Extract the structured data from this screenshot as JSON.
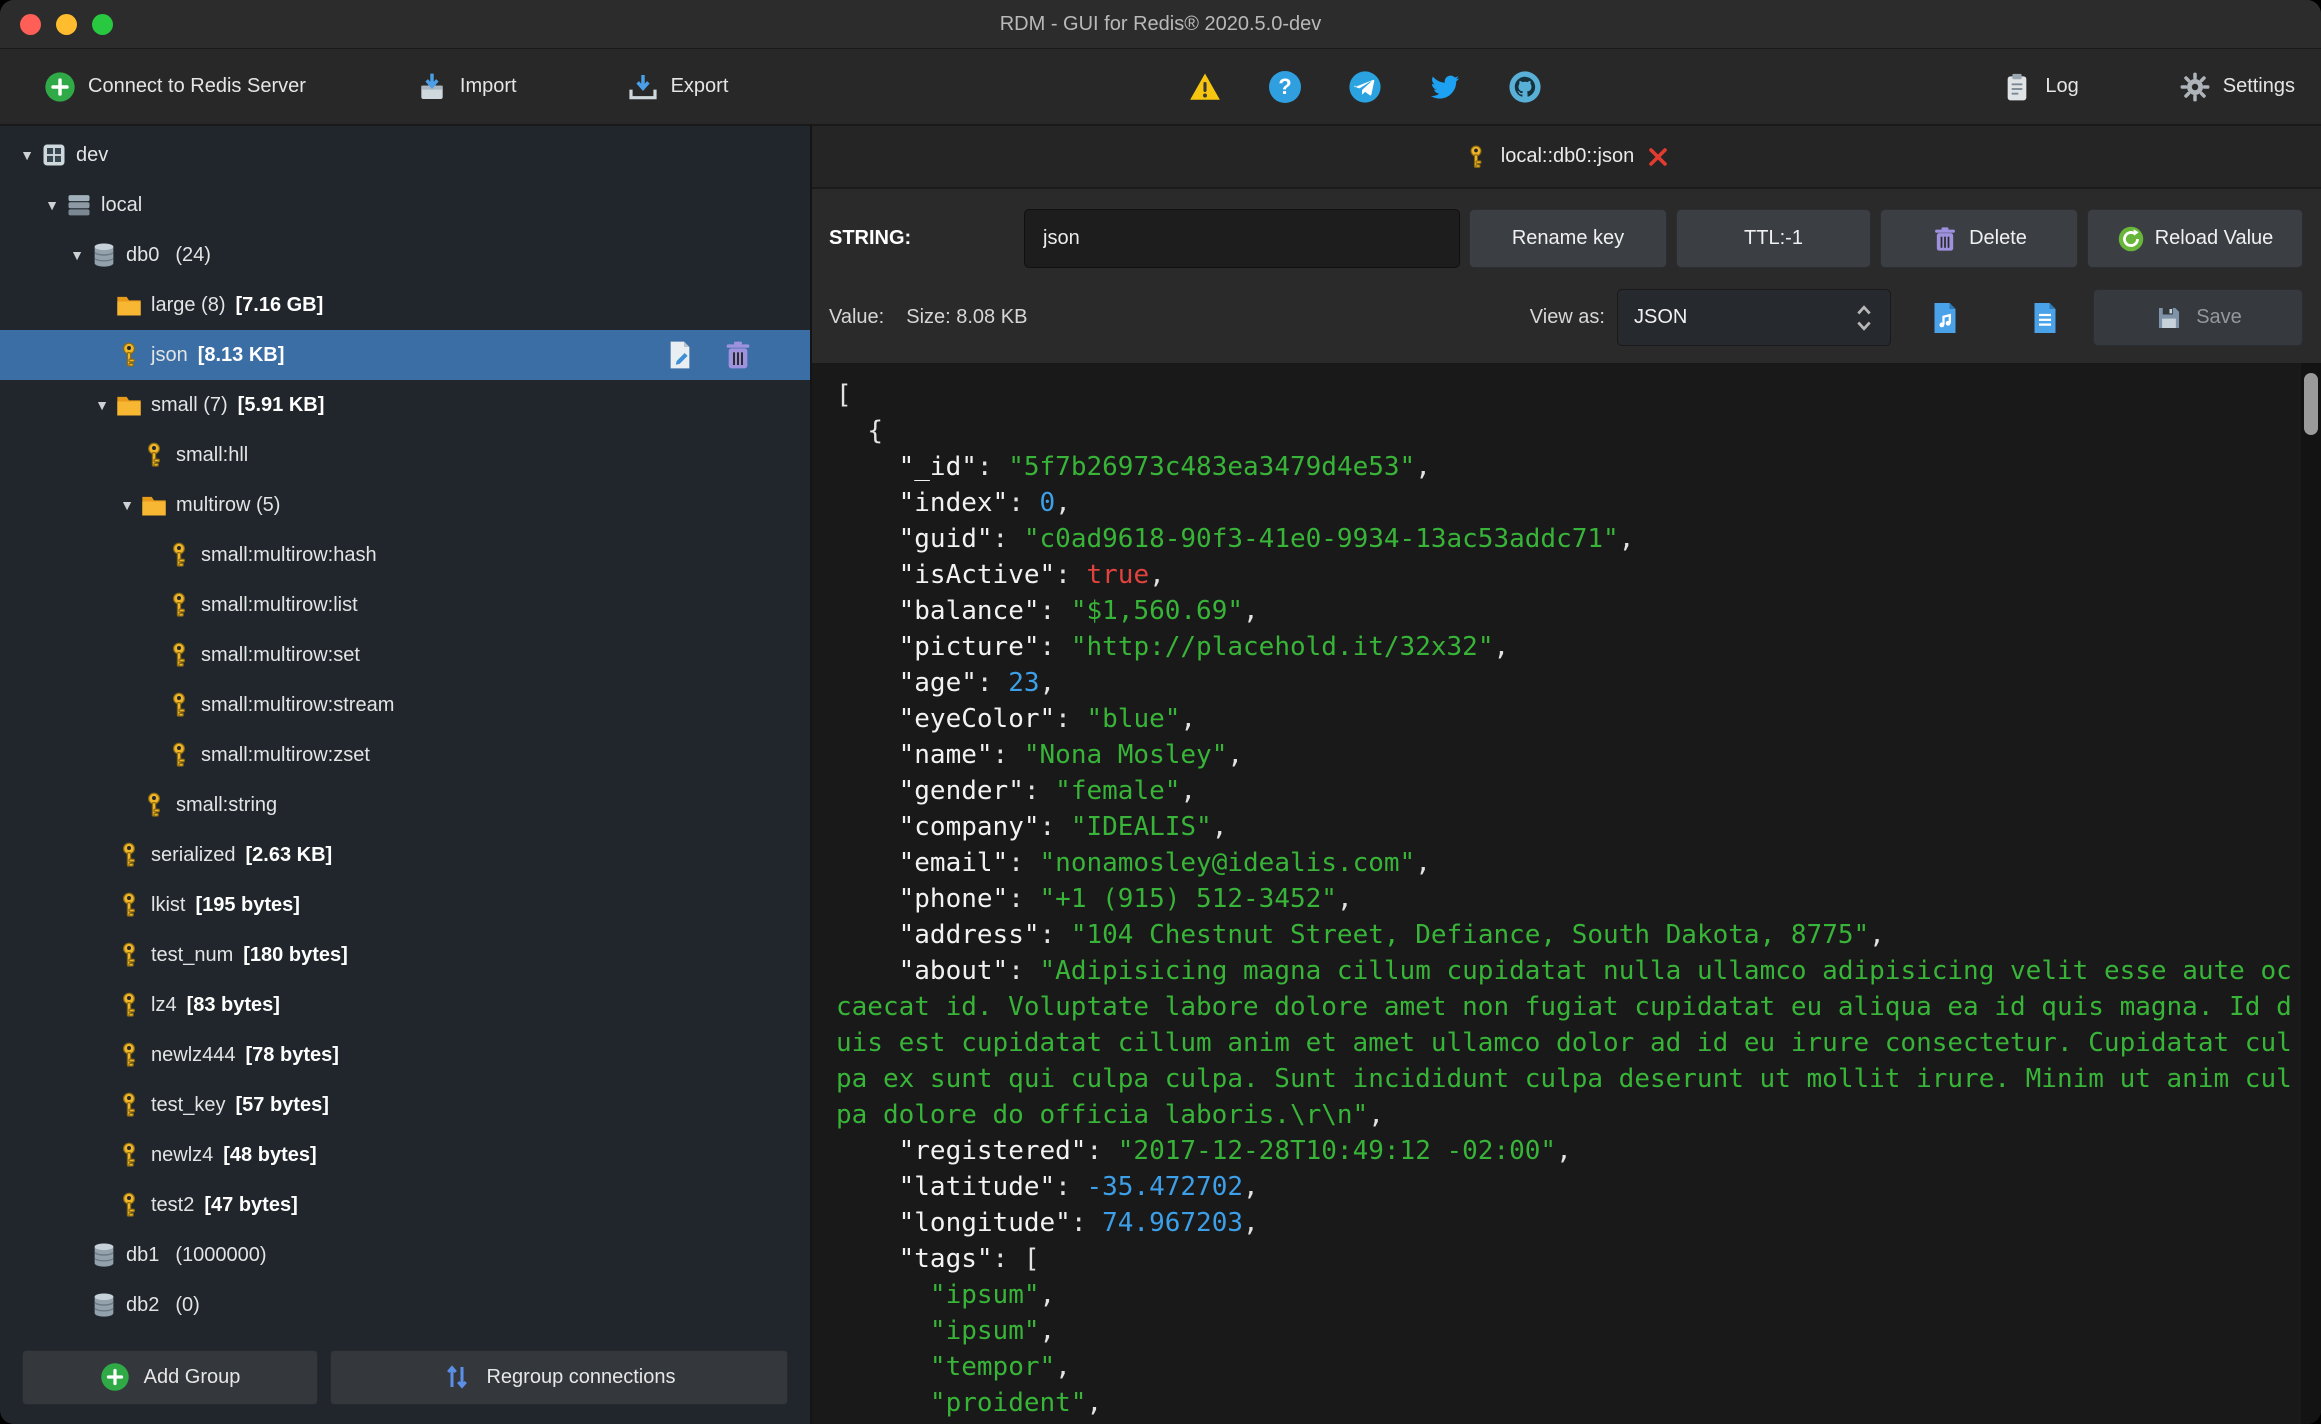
{
  "window": {
    "title": "RDM - GUI for Redis® 2020.5.0-dev"
  },
  "toolbar": {
    "connect": "Connect to Redis Server",
    "import": "Import",
    "export": "Export",
    "log": "Log",
    "settings": "Settings",
    "status_icons": [
      "warning",
      "help",
      "telegram",
      "twitter",
      "github"
    ]
  },
  "sidebar": {
    "tree": [
      {
        "level": 0,
        "expanded": true,
        "icon": "connection",
        "label": "dev"
      },
      {
        "level": 1,
        "expanded": true,
        "icon": "server",
        "label": "local"
      },
      {
        "level": 2,
        "expanded": true,
        "icon": "database",
        "label": "db0",
        "count": "(24)"
      },
      {
        "level": 3,
        "icon": "folder",
        "label": "large (8)",
        "size": "[7.16 GB]"
      },
      {
        "level": 3,
        "icon": "key",
        "label": "json",
        "size": "[8.13 KB]",
        "selected": true,
        "actions": true
      },
      {
        "level": 3,
        "expanded": true,
        "icon": "folder",
        "label": "small (7)",
        "size": "[5.91 KB]"
      },
      {
        "level": 4,
        "icon": "key",
        "label": "small:hll"
      },
      {
        "level": 4,
        "expanded": true,
        "icon": "folder",
        "label": "multirow (5)"
      },
      {
        "level": 5,
        "icon": "key",
        "label": "small:multirow:hash"
      },
      {
        "level": 5,
        "icon": "key",
        "label": "small:multirow:list"
      },
      {
        "level": 5,
        "icon": "key",
        "label": "small:multirow:set"
      },
      {
        "level": 5,
        "icon": "key",
        "label": "small:multirow:stream"
      },
      {
        "level": 5,
        "icon": "key",
        "label": "small:multirow:zset"
      },
      {
        "level": 4,
        "icon": "key",
        "label": "small:string"
      },
      {
        "level": 3,
        "icon": "key",
        "label": "serialized",
        "size": "[2.63 KB]"
      },
      {
        "level": 3,
        "icon": "key",
        "label": "lkist",
        "size": "[195 bytes]"
      },
      {
        "level": 3,
        "icon": "key",
        "label": "test_num",
        "size": "[180 bytes]"
      },
      {
        "level": 3,
        "icon": "key",
        "label": "lz4",
        "size": "[83 bytes]"
      },
      {
        "level": 3,
        "icon": "key",
        "label": "newlz444",
        "size": "[78 bytes]"
      },
      {
        "level": 3,
        "icon": "key",
        "label": "test_key",
        "size": "[57 bytes]"
      },
      {
        "level": 3,
        "icon": "key",
        "label": "newlz4",
        "size": "[48 bytes]"
      },
      {
        "level": 3,
        "icon": "key",
        "label": "test2",
        "size": "[47 bytes]"
      },
      {
        "level": 2,
        "icon": "database",
        "label": "db1",
        "count": "(1000000)"
      },
      {
        "level": 2,
        "icon": "database",
        "label": "db2",
        "count": "(0)"
      }
    ],
    "add_group": "Add Group",
    "regroup": "Regroup connections"
  },
  "main": {
    "tab": "local::db0::json",
    "key_editor": {
      "type_label": "STRING:",
      "key_name": "json",
      "rename": "Rename key",
      "ttl": "TTL:-1",
      "delete": "Delete",
      "reload": "Reload Value"
    },
    "value_bar": {
      "value_label": "Value:",
      "size": "Size: 8.08 KB",
      "view_as_label": "View as:",
      "view_as_value": "JSON",
      "save": "Save"
    },
    "json_lines": [
      "[",
      "  {",
      "    \"_id\": \"5f7b26973c483ea3479d4e53\",",
      "    \"index\": 0,",
      "    \"guid\": \"c0ad9618-90f3-41e0-9934-13ac53addc71\",",
      "    \"isActive\": true,",
      "    \"balance\": \"$1,560.69\",",
      "    \"picture\": \"http://placehold.it/32x32\",",
      "    \"age\": 23,",
      "    \"eyeColor\": \"blue\",",
      "    \"name\": \"Nona Mosley\",",
      "    \"gender\": \"female\",",
      "    \"company\": \"IDEALIS\",",
      "    \"email\": \"nonamosley@idealis.com\",",
      "    \"phone\": \"+1 (915) 512-3452\",",
      "    \"address\": \"104 Chestnut Street, Defiance, South Dakota, 8775\",",
      "    \"about\": \"Adipisicing magna cillum cupidatat nulla ullamco adipisicing velit esse aute occaecat id. Voluptate labore dolore amet non fugiat cupidatat eu aliqua ea id quis magna. Id duis est cupidatat cillum anim et amet ullamco dolor ad id eu irure consectetur. Cupidatat culpa ex sunt qui culpa culpa. Sunt incididunt culpa deserunt ut mollit irure. Minim ut anim culpa dolore do officia laboris.\\r\\n\",",
      "    \"registered\": \"2017-12-28T10:49:12 -02:00\",",
      "    \"latitude\": -35.472702,",
      "    \"longitude\": 74.967203,",
      "    \"tags\": [",
      "      \"ipsum\",",
      "      \"ipsum\",",
      "      \"tempor\",",
      "      \"proident\","
    ]
  },
  "colors": {
    "selection": "#3a6ea5",
    "json_string": "#38b438",
    "json_number": "#3d9fe8",
    "json_boolean": "#e0433d",
    "key_icon": "#f0b429",
    "folder_icon": "#f6a623"
  }
}
